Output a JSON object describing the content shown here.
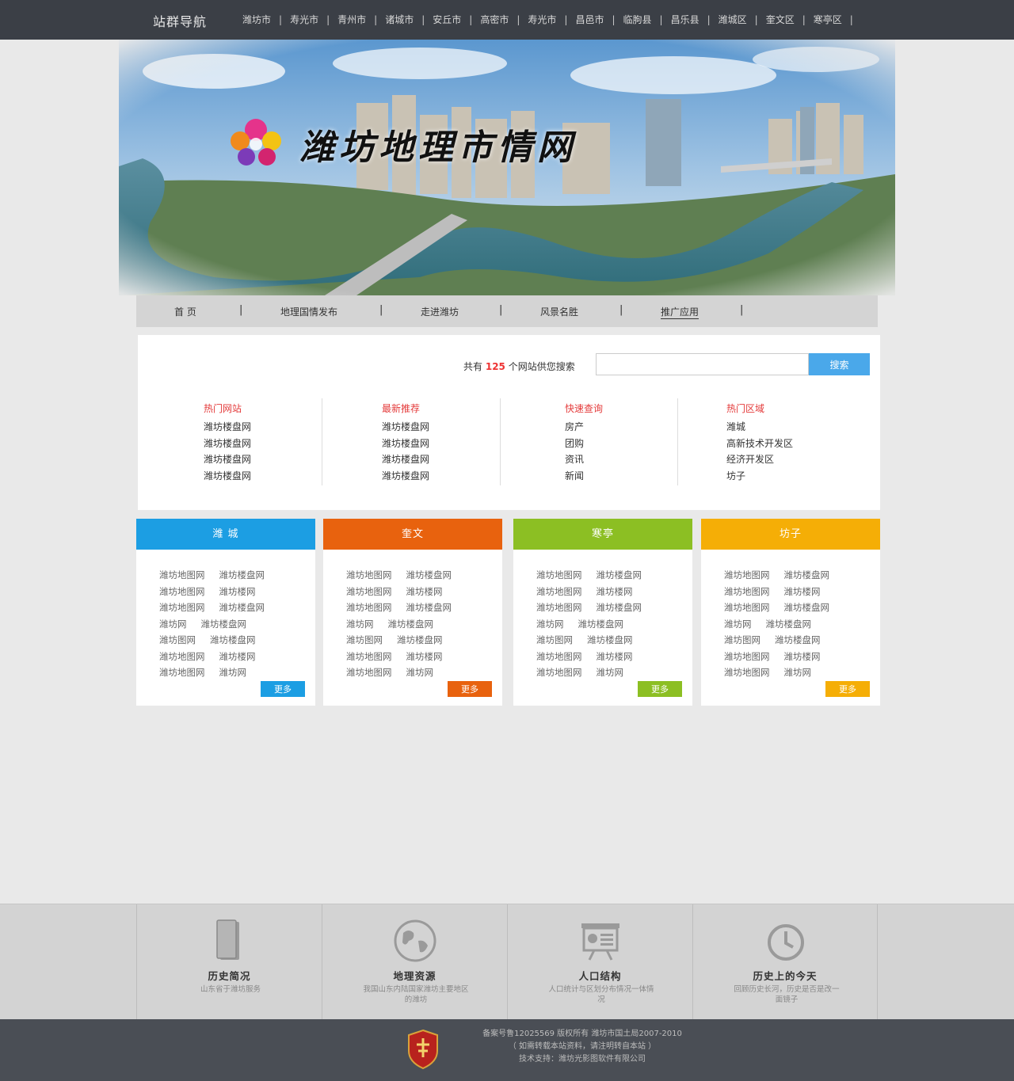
{
  "topbar": {
    "title": "站群导航",
    "cities": [
      "潍坊市",
      "寿光市",
      "青州市",
      "诸城市",
      "安丘市",
      "高密市",
      "寿光市",
      "昌邑市",
      "临朐县",
      "昌乐县",
      "潍城区",
      "奎文区",
      "寒亭区"
    ]
  },
  "banner": {
    "title": "潍坊地理市情网"
  },
  "mainnav": {
    "items": [
      "首 页",
      "地理国情发布",
      "走进潍坊",
      "风景名胜",
      "推广应用"
    ]
  },
  "search": {
    "prefix": "共有",
    "count": "125",
    "suffix": "个网站供您搜索",
    "button": "搜索",
    "value": ""
  },
  "columns": [
    {
      "title": "热门网站",
      "items": [
        "潍坊楼盘网",
        "潍坊楼盘网",
        "潍坊楼盘网",
        "潍坊楼盘网"
      ]
    },
    {
      "title": "最新推荐",
      "items": [
        "潍坊楼盘网",
        "潍坊楼盘网",
        "潍坊楼盘网",
        "潍坊楼盘网"
      ]
    },
    {
      "title": "快速查询",
      "items": [
        "房产",
        "团购",
        "资讯",
        "新闻"
      ]
    },
    {
      "title": "热门区域",
      "items": [
        "潍城",
        "高新技术开发区",
        "经济开发区",
        "坊子"
      ]
    }
  ],
  "districts": [
    {
      "name": "潍 城",
      "color": "#1c9ee3",
      "more": "更多",
      "rows": [
        [
          "潍坊地图网",
          "潍坊楼盘网"
        ],
        [
          "潍坊地图网",
          "潍坊楼网"
        ],
        [
          "潍坊地图网",
          "潍坊楼盘网"
        ],
        [
          "潍坊网",
          "潍坊楼盘网"
        ],
        [
          "潍坊图网",
          "潍坊楼盘网"
        ],
        [
          "潍坊地图网",
          "潍坊楼网"
        ],
        [
          "潍坊地图网",
          "潍坊网"
        ]
      ]
    },
    {
      "name": "奎文",
      "color": "#e8620e",
      "more": "更多",
      "rows": [
        [
          "潍坊地图网",
          "潍坊楼盘网"
        ],
        [
          "潍坊地图网",
          "潍坊楼网"
        ],
        [
          "潍坊地图网",
          "潍坊楼盘网"
        ],
        [
          "潍坊网",
          "潍坊楼盘网"
        ],
        [
          "潍坊图网",
          "潍坊楼盘网"
        ],
        [
          "潍坊地图网",
          "潍坊楼网"
        ],
        [
          "潍坊地图网",
          "潍坊网"
        ]
      ]
    },
    {
      "name": "寒亭",
      "color": "#8cbf23",
      "more": "更多",
      "rows": [
        [
          "潍坊地图网",
          "潍坊楼盘网"
        ],
        [
          "潍坊地图网",
          "潍坊楼网"
        ],
        [
          "潍坊地图网",
          "潍坊楼盘网"
        ],
        [
          "潍坊网",
          "潍坊楼盘网"
        ],
        [
          "潍坊图网",
          "潍坊楼盘网"
        ],
        [
          "潍坊地图网",
          "潍坊楼网"
        ],
        [
          "潍坊地图网",
          "潍坊网"
        ]
      ]
    },
    {
      "name": "坊子",
      "color": "#f5ae06",
      "more": "更多",
      "rows": [
        [
          "潍坊地图网",
          "潍坊楼盘网"
        ],
        [
          "潍坊地图网",
          "潍坊楼网"
        ],
        [
          "潍坊地图网",
          "潍坊楼盘网"
        ],
        [
          "潍坊网",
          "潍坊楼盘网"
        ],
        [
          "潍坊图网",
          "潍坊楼盘网"
        ],
        [
          "潍坊地图网",
          "潍坊楼网"
        ],
        [
          "潍坊地图网",
          "潍坊网"
        ]
      ]
    }
  ],
  "features": [
    {
      "title": "历史简况",
      "desc": "山东省于潍坊服务",
      "icon": "book-icon"
    },
    {
      "title": "地理资源",
      "desc": "我国山东内陆国家潍坊主要地区的潍坊",
      "icon": "globe-icon"
    },
    {
      "title": "人口结构",
      "desc": "人口统计与区划分布情况一体情况",
      "icon": "presentation-icon"
    },
    {
      "title": "历史上的今天",
      "desc": "回顾历史长河，历史是否是改一面镜子",
      "icon": "clock-icon"
    }
  ],
  "footer": {
    "line1": "备案号鲁12025569 版权所有 潍坊市国土局2007-2010",
    "line2": "（ 如需转载本站资料，请注明转自本站 ）",
    "line3": "技术支持：潍坊光影图软件有限公司"
  }
}
